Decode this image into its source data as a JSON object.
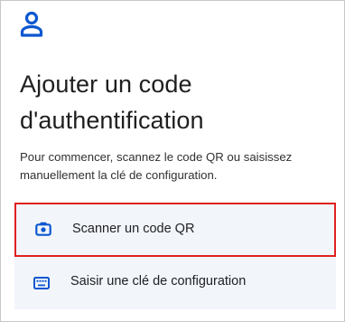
{
  "header": {
    "icon": "person-outline-icon",
    "title": "Ajouter un code d'authentification",
    "subtitle": "Pour commencer, scannez le code QR ou saisissez manuellement la clé de configuration."
  },
  "options": [
    {
      "label": "Scanner un code QR",
      "icon": "camera-icon",
      "highlighted": true
    },
    {
      "label": "Saisir une clé de configuration",
      "icon": "keyboard-icon",
      "highlighted": false
    }
  ],
  "colors": {
    "accent": "#0b57d0",
    "option_background": "#f2f5fa",
    "highlight_border": "#e02020"
  }
}
